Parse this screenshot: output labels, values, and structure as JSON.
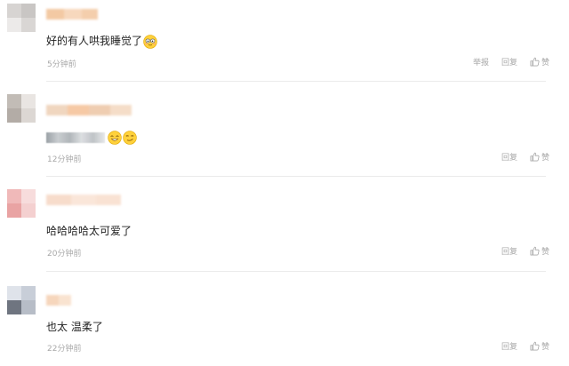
{
  "actions": {
    "report_label": "举报",
    "reply_label": "回复",
    "like_label": "赞"
  },
  "comments": [
    {
      "text": "好的有人哄我睡觉了",
      "time": "5分钟前",
      "emoji": "shy-face-emoji"
    },
    {
      "text": "",
      "time": "12分钟前",
      "emoji": "grinning-face-emoji"
    },
    {
      "text": "哈哈哈哈太可爱了",
      "time": "20分钟前"
    },
    {
      "text": "也太 温柔了",
      "time": "22分钟前"
    }
  ]
}
